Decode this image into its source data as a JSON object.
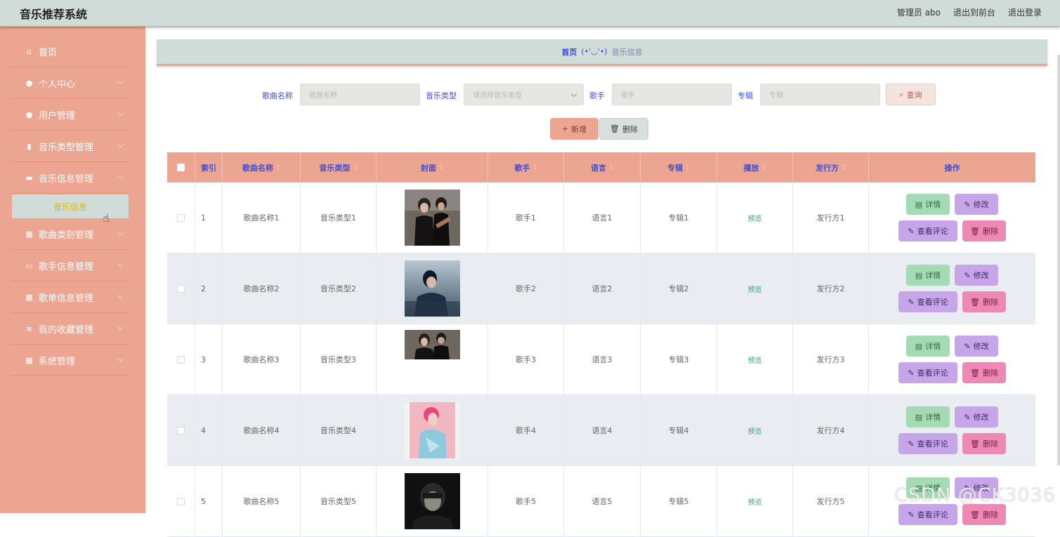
{
  "header": {
    "app_title": "音乐推荐系统",
    "admin": "管理员 abo",
    "to_front": "退出到前台",
    "logout": "退出登录"
  },
  "sidebar": {
    "items": [
      {
        "label": "首页",
        "icon": "home-icon"
      },
      {
        "label": "个人中心",
        "icon": "person-icon"
      },
      {
        "label": "用户管理",
        "icon": "users-icon"
      },
      {
        "label": "音乐类型管理",
        "icon": "clipboard-icon"
      },
      {
        "label": "音乐信息管理",
        "icon": "chat-icon"
      },
      {
        "label": "歌曲类别管理",
        "icon": "grid-icon"
      },
      {
        "label": "歌手信息管理",
        "icon": "briefcase-icon"
      },
      {
        "label": "歌单信息管理",
        "icon": "grid-icon"
      },
      {
        "label": "我的收藏管理",
        "icon": "list-icon"
      },
      {
        "label": "系统管理",
        "icon": "grid-icon"
      }
    ],
    "active_sub": "音乐信息"
  },
  "breadcrumb": {
    "home": "首页",
    "sep": "(•'◡'•)",
    "current": "音乐信息"
  },
  "search": {
    "song_label": "歌曲名称",
    "song_placeholder": "歌曲名称",
    "type_label": "音乐类型",
    "type_placeholder": "请选择音乐类型",
    "singer_label": "歌手",
    "singer_placeholder": "歌手",
    "album_label": "专辑",
    "album_placeholder": "专辑",
    "query_button": "查询"
  },
  "actions": {
    "add": "新增",
    "delete": "删除"
  },
  "table": {
    "headers": {
      "index": "索引",
      "song": "歌曲名称",
      "type": "音乐类型",
      "cover": "封面",
      "singer": "歌手",
      "language": "语言",
      "album": "专辑",
      "play": "播放",
      "publisher": "发行方",
      "ops": "操作"
    },
    "rows": [
      {
        "index": "1",
        "song": "歌曲名称1",
        "type": "音乐类型1",
        "singer": "歌手1",
        "language": "语言1",
        "album": "专辑1",
        "play": "预览",
        "publisher": "发行方1"
      },
      {
        "index": "2",
        "song": "歌曲名称2",
        "type": "音乐类型2",
        "singer": "歌手2",
        "language": "语言2",
        "album": "专辑2",
        "play": "预览",
        "publisher": "发行方2"
      },
      {
        "index": "3",
        "song": "歌曲名称3",
        "type": "音乐类型3",
        "singer": "歌手3",
        "language": "语言3",
        "album": "专辑3",
        "play": "预览",
        "publisher": "发行方3"
      },
      {
        "index": "4",
        "song": "歌曲名称4",
        "type": "音乐类型4",
        "singer": "歌手4",
        "language": "语言4",
        "album": "专辑4",
        "play": "预览",
        "publisher": "发行方4"
      },
      {
        "index": "5",
        "song": "歌曲名称5",
        "type": "音乐类型5",
        "singer": "歌手5",
        "language": "语言5",
        "album": "专辑5",
        "play": "预览",
        "publisher": "发行方5"
      }
    ],
    "op_labels": {
      "detail": "详情",
      "edit": "修改",
      "comments": "查看评论",
      "remove": "删除"
    }
  },
  "watermark": "CSDN @CK3036",
  "colors": {
    "header_bg": "#cfdcd8",
    "sidebar_bg": "#eca591",
    "accent_blue": "#3d4ed8",
    "preview_green": "#2ea67b"
  }
}
